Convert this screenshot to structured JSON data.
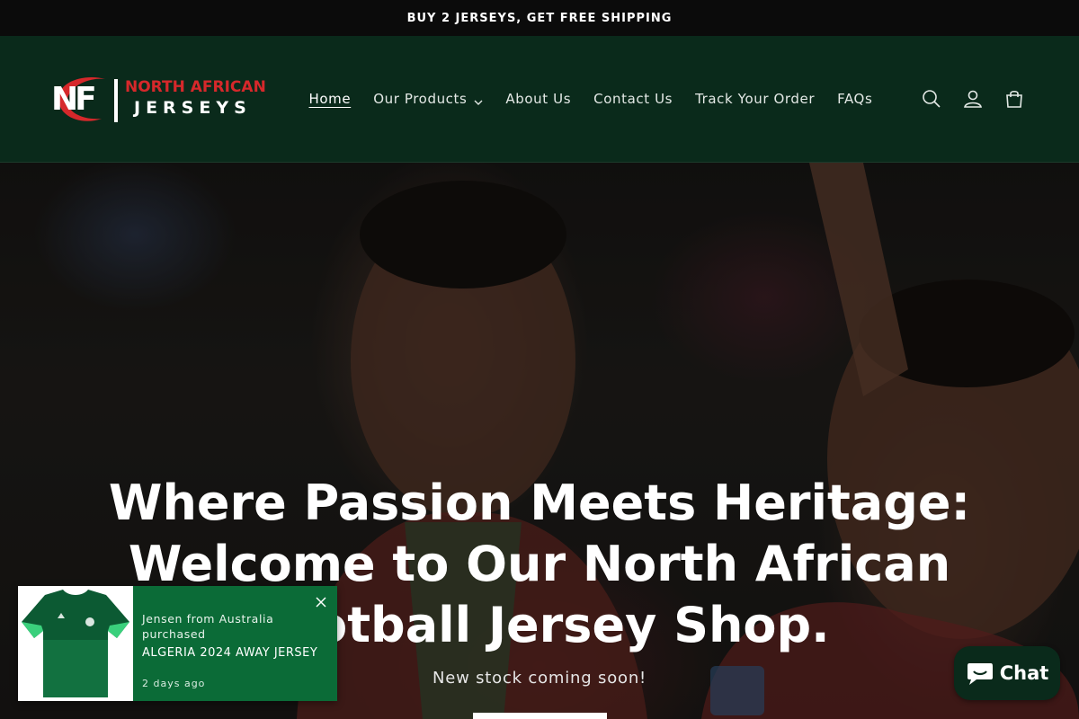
{
  "announcement": {
    "text": "BUY 2 JERSEYS, GET FREE SHIPPING"
  },
  "brand": {
    "line1": "NORTH AFRICAN",
    "line2": "JERSEYS",
    "monogram": "NF",
    "accent": "#d6282b",
    "header_bg": "#0a2a1b"
  },
  "nav": {
    "items": [
      {
        "label": "Home",
        "active": true
      },
      {
        "label": "Our Products",
        "has_dropdown": true
      },
      {
        "label": "About Us"
      },
      {
        "label": "Contact Us"
      },
      {
        "label": "Track Your Order"
      },
      {
        "label": "FAQs"
      }
    ]
  },
  "header_icons": [
    "search-icon",
    "account-icon",
    "cart-icon"
  ],
  "hero": {
    "heading": "Where Passion Meets Heritage: Welcome to Our North African Football Jersey Shop.",
    "subheading": "New stock coming soon!"
  },
  "popup": {
    "message": "Jensen from Australia purchased",
    "product": "ALGERIA 2024 AWAY JERSEY",
    "time": "2 days ago",
    "bg": "#0b6b37"
  },
  "chat": {
    "label": "Chat"
  }
}
